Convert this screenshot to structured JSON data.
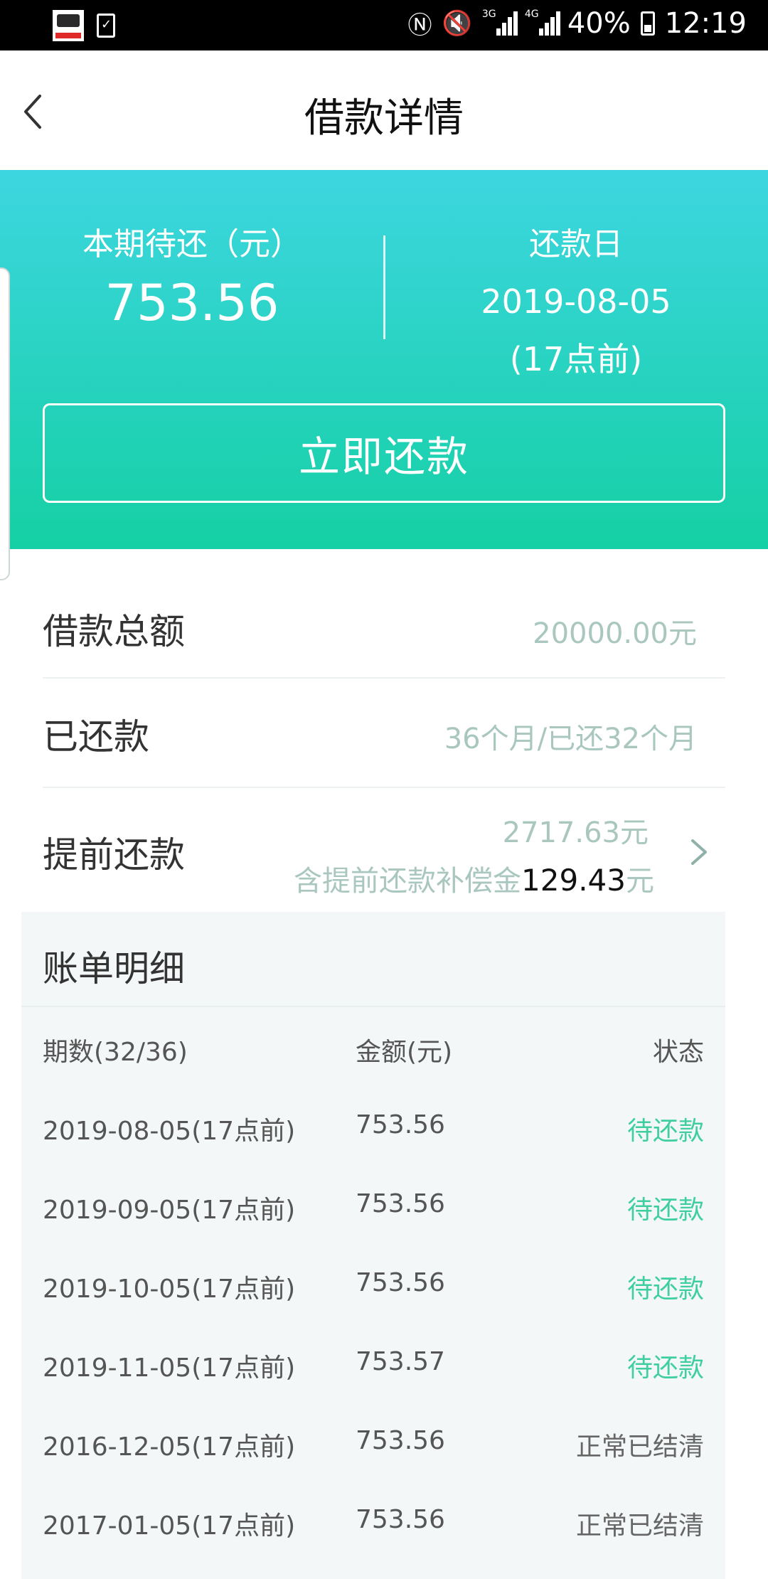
{
  "status_bar": {
    "battery": "40%",
    "time": "12:19",
    "net1": "3G",
    "net2": "4G"
  },
  "header": {
    "title": "借款详情"
  },
  "hero": {
    "due_label": "本期待还（元）",
    "due_amount": "753.56",
    "date_label": "还款日",
    "date_value": "2019-08-05",
    "date_note": "(17点前)",
    "repay_button": "立即还款"
  },
  "summary": {
    "total_label": "借款总额",
    "total_value": "20000.00元",
    "paid_label": "已还款",
    "paid_value": "36个月/已还32个月",
    "prepay_label": "提前还款",
    "prepay_amount": "2717.63元",
    "prepay_note_prefix": "含提前还款补偿金",
    "prepay_note_amount": "129.43",
    "prepay_note_suffix": "元"
  },
  "bill": {
    "title": "账单明细",
    "columns": [
      "期数(32/36)",
      "金额(元)",
      "状态"
    ],
    "rows": [
      {
        "date": "2019-08-05(17点前)",
        "amount": "753.56",
        "status": "待还款"
      },
      {
        "date": "2019-09-05(17点前)",
        "amount": "753.56",
        "status": "待还款"
      },
      {
        "date": "2019-10-05(17点前)",
        "amount": "753.56",
        "status": "待还款"
      },
      {
        "date": "2019-11-05(17点前)",
        "amount": "753.57",
        "status": "待还款"
      },
      {
        "date": "2016-12-05(17点前)",
        "amount": "753.56",
        "status": "正常已结清"
      },
      {
        "date": "2017-01-05(17点前)",
        "amount": "753.56",
        "status": "正常已结清"
      }
    ]
  },
  "colors": {
    "hero_top": "#3dd6e0",
    "hero_bottom": "#15d0a4",
    "pending": "#3fcf9e",
    "muted_value": "#a9c7bf"
  }
}
